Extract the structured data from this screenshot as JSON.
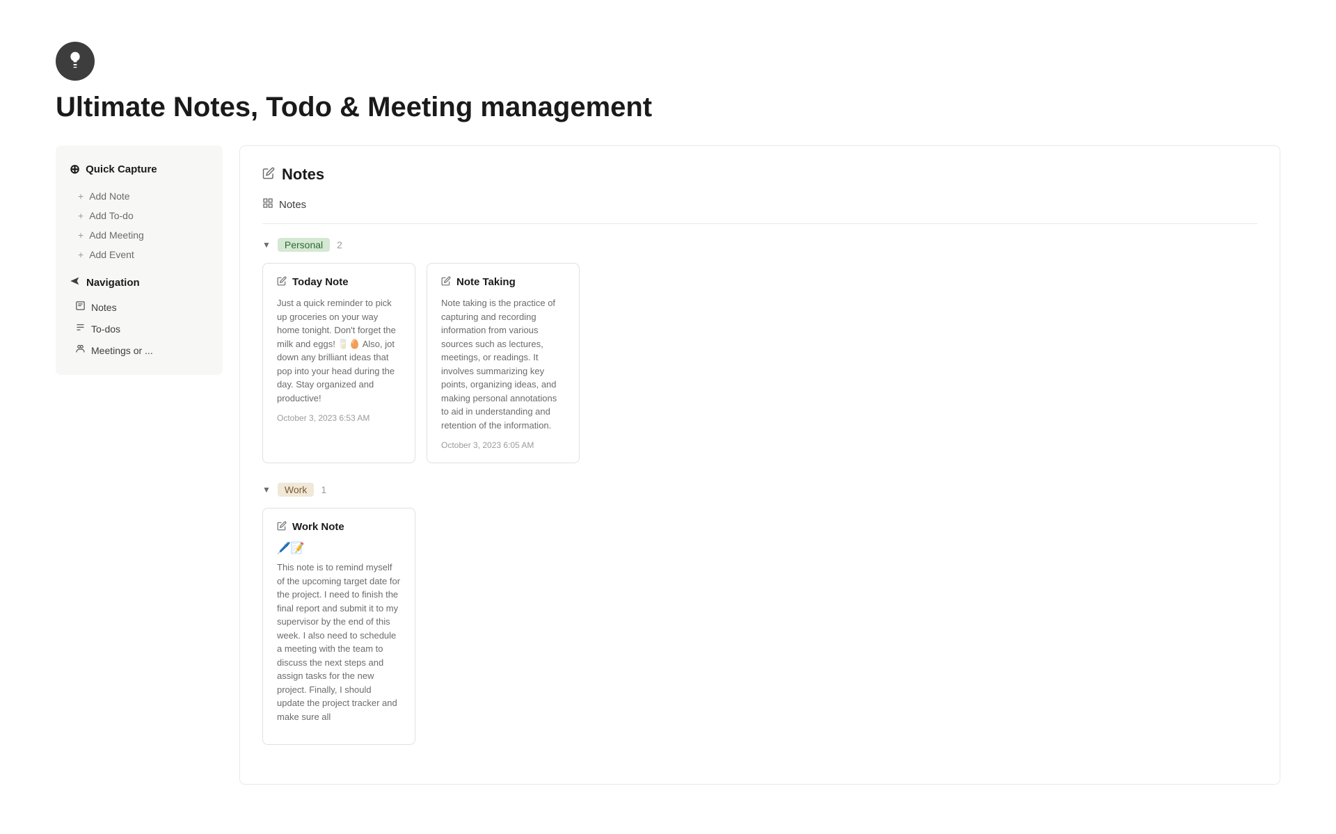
{
  "app": {
    "title": "Ultimate Notes, Todo & Meeting management"
  },
  "sidebar": {
    "quick_capture_label": "Quick Capture",
    "quick_capture_icon": "⊕",
    "actions": [
      {
        "label": "Add Note",
        "icon": "+"
      },
      {
        "label": "Add To-do",
        "icon": "+"
      },
      {
        "label": "Add Meeting",
        "icon": "+"
      },
      {
        "label": "Add Event",
        "icon": "+"
      }
    ],
    "navigation_label": "Navigation",
    "navigation_icon": "◈",
    "nav_items": [
      {
        "label": "Notes",
        "icon": "✎"
      },
      {
        "label": "To-dos",
        "icon": "≡"
      },
      {
        "label": "Meetings or ...",
        "icon": "⚇"
      }
    ]
  },
  "main": {
    "section_title": "Notes",
    "view_label": "Notes",
    "groups": [
      {
        "id": "personal",
        "tag": "Personal",
        "tag_class": "tag-personal",
        "count": 2,
        "cards": [
          {
            "title": "Today Note",
            "body": "Just a quick reminder to pick up groceries on your way home tonight. Don't forget the milk and eggs! 🥛🥚 Also, jot down any brilliant ideas that pop into your head during the day. Stay organized and productive!",
            "emoji": "",
            "date": "October 3, 2023 6:53 AM"
          },
          {
            "title": "Note Taking",
            "body": "Note taking is the practice of capturing and recording information from various sources such as lectures, meetings, or readings. It involves summarizing key points, organizing ideas, and making personal annotations to aid in understanding and retention of the information.",
            "emoji": "",
            "date": "October 3, 2023 6:05 AM"
          }
        ]
      },
      {
        "id": "work",
        "tag": "Work",
        "tag_class": "tag-work",
        "count": 1,
        "cards": [
          {
            "title": "Work Note",
            "body": "This note is to remind myself of the upcoming target date for the project. I need to finish the final report and submit it to my supervisor by the end of this week. I also need to schedule a meeting with the team to discuss the next steps and assign tasks for the new project. Finally, I should update the project tracker and make sure all",
            "emoji": "🖊️📝",
            "date": ""
          }
        ]
      }
    ]
  }
}
